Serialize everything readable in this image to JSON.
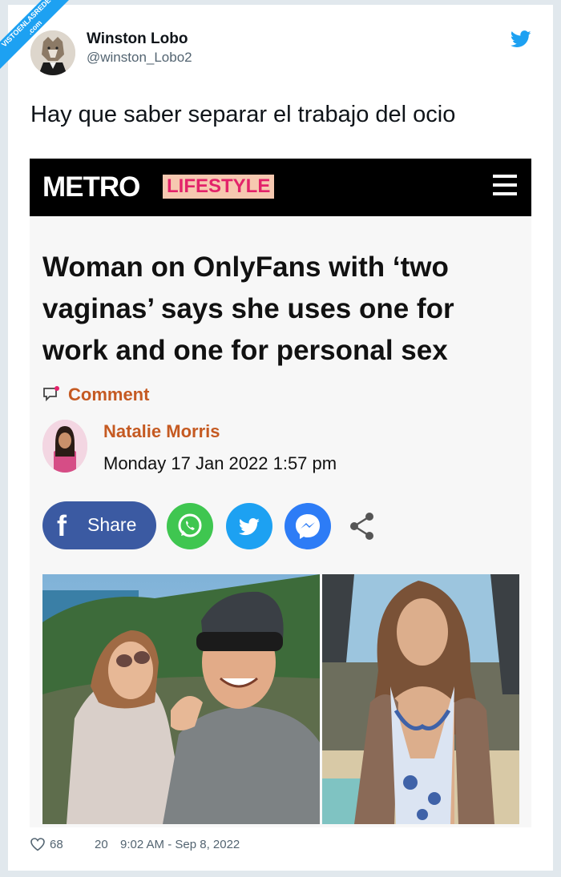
{
  "watermark": {
    "line1": "VISTOENLASREDES",
    "line2": ".com"
  },
  "tweet": {
    "author_name": "Winston Lobo",
    "author_handle": "@winston_Lobo2",
    "text": "Hay que saber separar el trabajo del ocio",
    "likes": "68",
    "retweets": "20",
    "timestamp": "9:02 AM - Sep 8, 2022"
  },
  "article": {
    "logo": "METRO",
    "section": "LIFESTYLE",
    "headline": "Woman on OnlyFans with ‘two vaginas’ says she uses one for work and one for personal sex",
    "comment_label": "Comment",
    "author": "Natalie Morris",
    "date": "Monday 17 Jan 2022 1:57 pm",
    "share_label": "Share"
  },
  "icons": [
    "twitter-bird-icon",
    "menu-icon",
    "comment-icon",
    "facebook-icon",
    "whatsapp-icon",
    "twitter-icon",
    "messenger-icon",
    "share-icon",
    "heart-icon"
  ],
  "colors": {
    "twitter_blue": "#1da1f2",
    "metro_section_pink": "#e3226a",
    "metro_accent_orange": "#c55a22",
    "facebook_blue": "#3b5aa2",
    "whatsapp_green": "#3fc650",
    "messenger_blue": "#2d7cf6"
  }
}
